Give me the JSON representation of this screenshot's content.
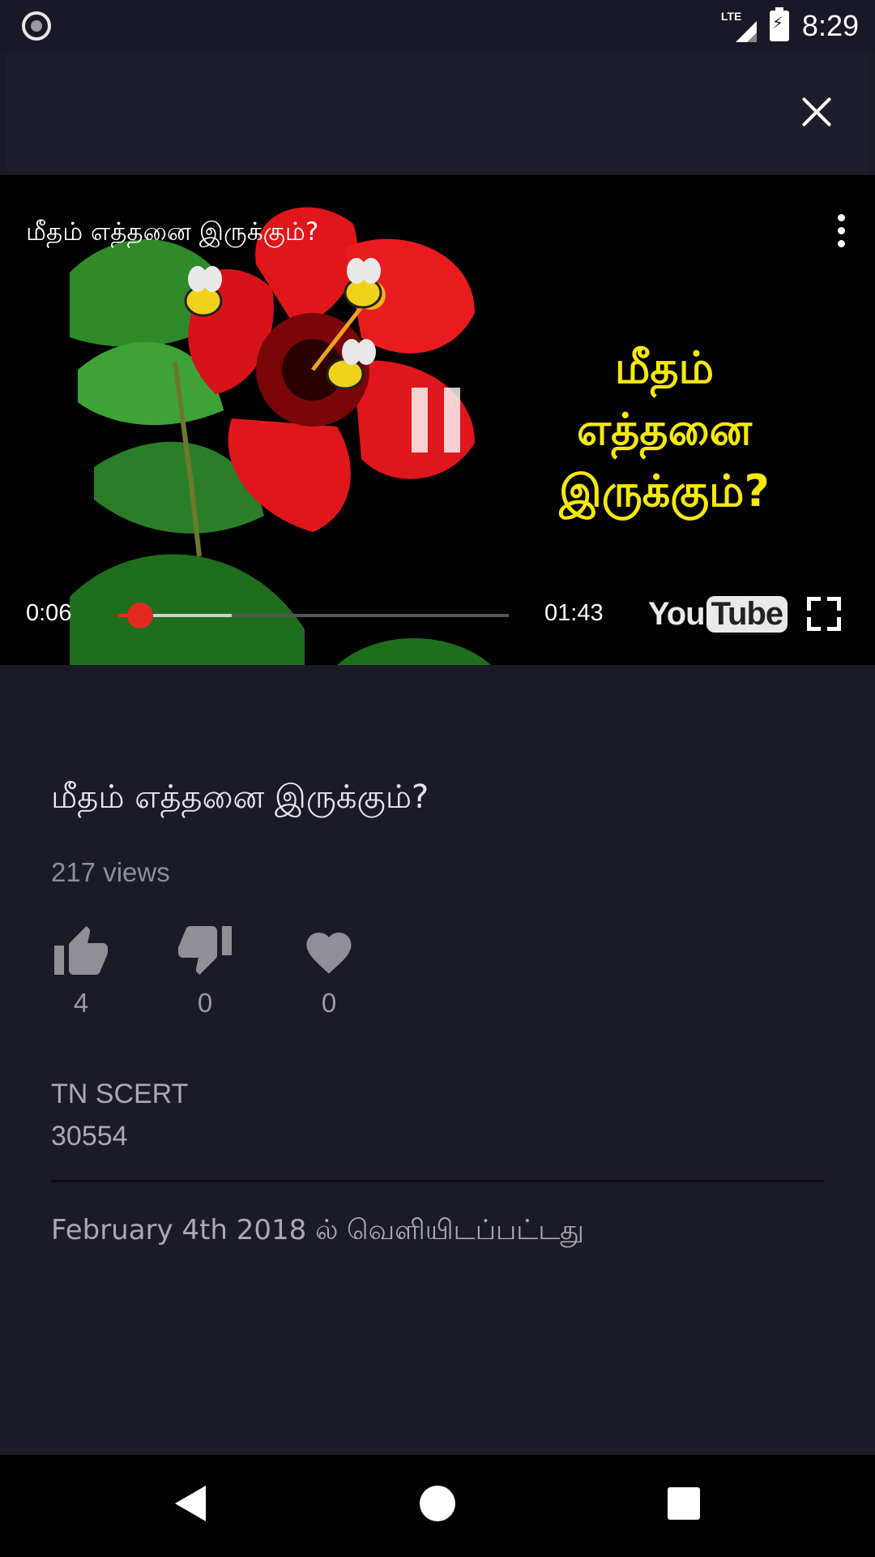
{
  "status_bar": {
    "network": "LTE",
    "time": "8:29"
  },
  "player": {
    "title": "மீதம் எத்தனை இருக்கும்?",
    "overlay_lines": [
      "மீதம்",
      "எத்தனை",
      "இருக்கும்?"
    ],
    "current_time": "0:06",
    "total_time": "01:43",
    "progress_fraction": 0.056,
    "buffered_fraction": 0.29,
    "logo_you": "You",
    "logo_tube": "Tube"
  },
  "video": {
    "title": "மீதம் எத்தனை இருக்கும்?",
    "views": "217 views",
    "likes": "4",
    "dislikes": "0",
    "favorites": "0",
    "channel": "TN SCERT",
    "channel_id": "30554",
    "published": "February 4th 2018 ல் வெளியிடப்பட்டது"
  },
  "colors": {
    "accent_red": "#e12b1e",
    "overlay_yellow": "#f5e80c",
    "background": "#1b1b27"
  },
  "icons": [
    "close-icon",
    "more-vert-icon",
    "pause-icon",
    "fullscreen-icon",
    "thumb-up-icon",
    "thumb-down-icon",
    "heart-icon",
    "nav-back-icon",
    "nav-home-icon",
    "nav-recents-icon"
  ]
}
